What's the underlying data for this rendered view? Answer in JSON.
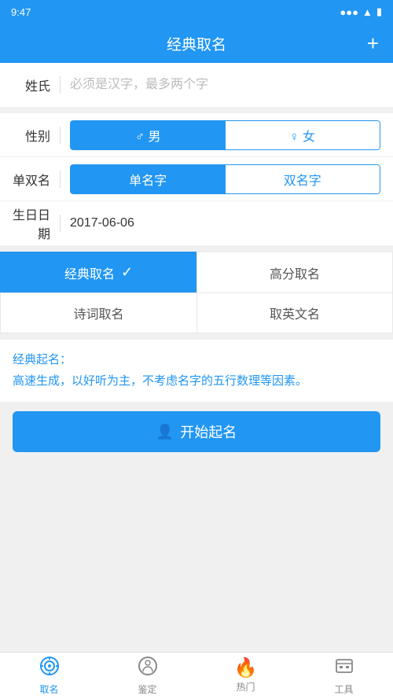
{
  "statusBar": {
    "time": "9:47",
    "signal": "●●●",
    "wifi": "WiFi",
    "battery": "▮"
  },
  "header": {
    "title": "经典取名",
    "plusLabel": "+"
  },
  "form": {
    "surnameLabel": "姓氏",
    "surnamePlaceholder": "必须是汉字，最多两个字",
    "genderLabel": "性别",
    "genderMale": "♂ 男",
    "genderFemale": "♀ 女",
    "nameTypeLabel": "单双名",
    "nameSingle": "单名字",
    "nameDouble": "双名字",
    "birthdayLabel": "生日日期",
    "birthdayValue": "2017-06-06"
  },
  "tabs": [
    {
      "label": "经典取名",
      "active": true,
      "hasCheck": true
    },
    {
      "label": "高分取名",
      "active": false,
      "hasCheck": false
    },
    {
      "label": "诗词取名",
      "active": false,
      "hasCheck": false
    },
    {
      "label": "取英文名",
      "active": false,
      "hasCheck": false
    }
  ],
  "description": {
    "title": "经典起名：",
    "body": "高速生成，以好听为主，不考虑名字的五行数理等因素。"
  },
  "startButton": {
    "label": "开始起名",
    "icon": "👤"
  },
  "bottomNav": [
    {
      "icon": "⚙",
      "label": "取名",
      "active": true
    },
    {
      "icon": "◎",
      "label": "鉴定",
      "active": false
    },
    {
      "icon": "🔥",
      "label": "热门",
      "active": false
    },
    {
      "icon": "🧰",
      "label": "工具",
      "active": false
    }
  ]
}
